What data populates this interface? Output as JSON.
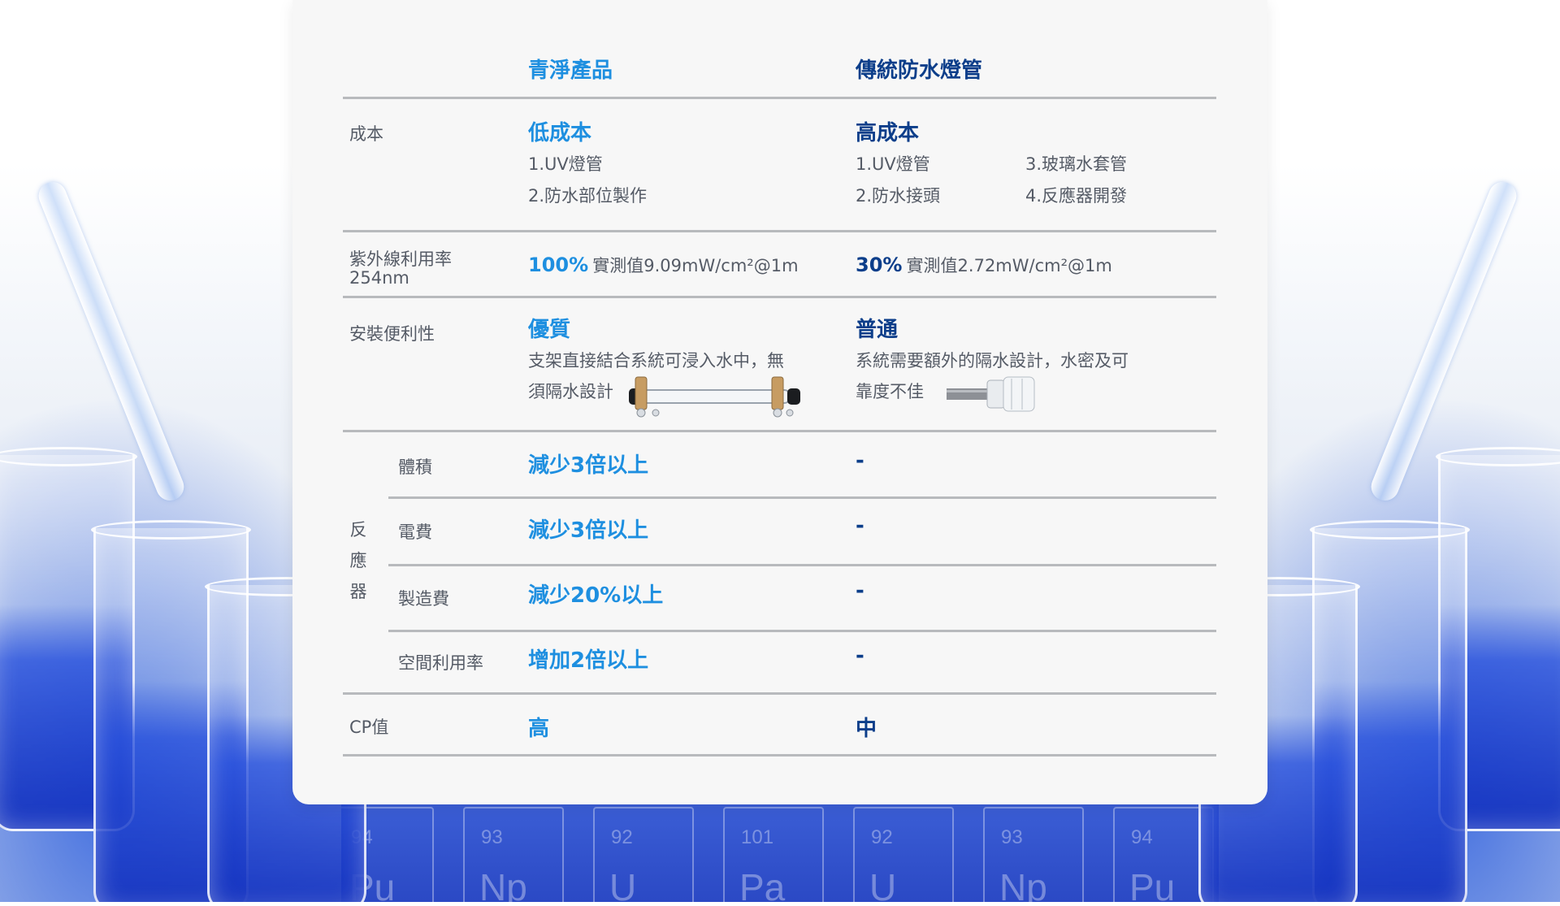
{
  "columns": {
    "product": "青淨產品",
    "traditional": "傳統防水燈管"
  },
  "rows": {
    "cost": {
      "label": "成本",
      "product_title": "低成本",
      "product_items": [
        "1.UV燈管",
        "2.防水部位製作"
      ],
      "traditional_title": "高成本",
      "traditional_items": [
        "1.UV燈管",
        "2.防水接頭",
        "3.玻璃水套管",
        "4.反應器開發"
      ]
    },
    "uv": {
      "label_line1": "紫外線利用率",
      "label_line2": "254nm",
      "product_percent": "100%",
      "product_measure": "實測值9.09mW/cm²@1m",
      "traditional_percent": "30%",
      "traditional_measure": "實測值2.72mW/cm²@1m"
    },
    "install": {
      "label": "安裝便利性",
      "product_title": "優質",
      "product_desc_line1": "支架直接結合系統可浸入水中，無",
      "product_desc_line2": "須隔水設計",
      "traditional_title": "普通",
      "traditional_desc_line1": "系統需要額外的隔水設計，水密及可",
      "traditional_desc_line2": "靠度不佳"
    },
    "reactor": {
      "group_label": "反應器",
      "items": [
        {
          "label": "體積",
          "product": "減少3倍以上",
          "traditional": "-"
        },
        {
          "label": "電費",
          "product": "減少3倍以上",
          "traditional": "-"
        },
        {
          "label": "製造費",
          "product": "減少20%以上",
          "traditional": "-"
        },
        {
          "label": "空間利用率",
          "product": "增加2倍以上",
          "traditional": "-"
        }
      ]
    },
    "cp": {
      "label": "CP值",
      "product": "高",
      "traditional": "中"
    }
  },
  "background": {
    "periodic_symbols": [
      "Pu",
      "Np",
      "U",
      "Pa",
      "U",
      "Np",
      "Pu"
    ],
    "periodic_numbers": [
      "94",
      "93",
      "92",
      "101",
      "92",
      "93",
      "94"
    ]
  },
  "colors": {
    "product_accent": "#1e8fe0",
    "traditional_accent": "#0c3e8a",
    "rule": "#b8babd",
    "card": "#f7f7f7"
  }
}
